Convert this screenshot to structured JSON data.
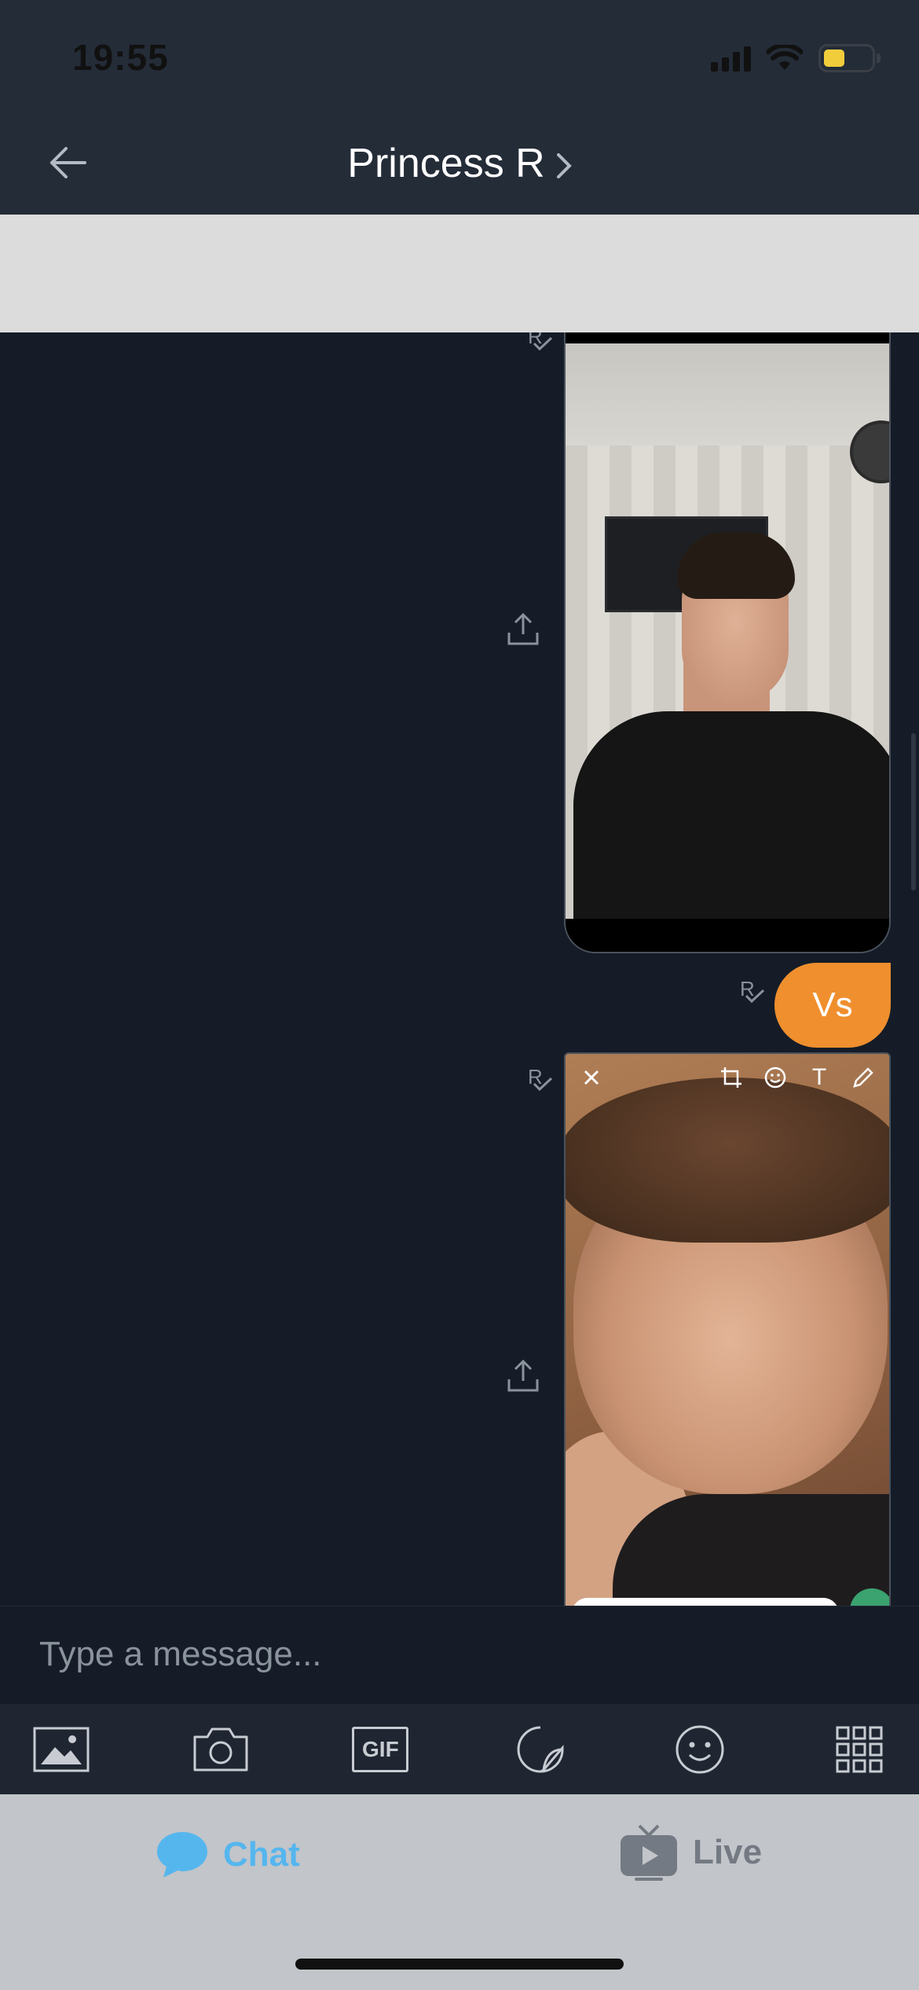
{
  "status_bar": {
    "time": "19:55",
    "icons": [
      "cellular-signal-icon",
      "wifi-icon",
      "battery-icon"
    ],
    "battery_color": "#f2cd3b"
  },
  "header": {
    "back_icon": "arrow-left-icon",
    "title": "Princess R",
    "chevron_icon": "chevron-right-icon"
  },
  "messages": [
    {
      "type": "image",
      "direction": "outgoing",
      "read_mark": "R",
      "share_icon": "share-icon",
      "description_icon": "photo"
    },
    {
      "type": "text",
      "direction": "outgoing",
      "read_mark": "R",
      "text": "Vs",
      "bubble_color": "#ef8f2e"
    },
    {
      "type": "image",
      "direction": "outgoing",
      "read_mark": "R",
      "share_icon": "share-icon",
      "editor_tools": [
        "close-icon",
        "crop-icon",
        "emoji-icon",
        "text-icon",
        "pencil-icon"
      ],
      "text_tool_label": "T"
    }
  ],
  "composer": {
    "placeholder": "Type a message..."
  },
  "attach_bar": {
    "items": [
      "gallery-icon",
      "camera-icon",
      "gif-icon",
      "sticker-icon",
      "emoji-icon",
      "apps-grid-icon"
    ],
    "gif_label": "GIF"
  },
  "tabs": [
    {
      "label": "Chat",
      "icon": "chat-bubble-icon",
      "active": true,
      "color": "#55b6ee"
    },
    {
      "label": "Live",
      "icon": "tv-icon",
      "active": false,
      "color": "#747a83"
    }
  ],
  "colors": {
    "header_bg": "#242c38",
    "chat_bg": "#151c27",
    "accent_orange": "#ef8f2e"
  }
}
